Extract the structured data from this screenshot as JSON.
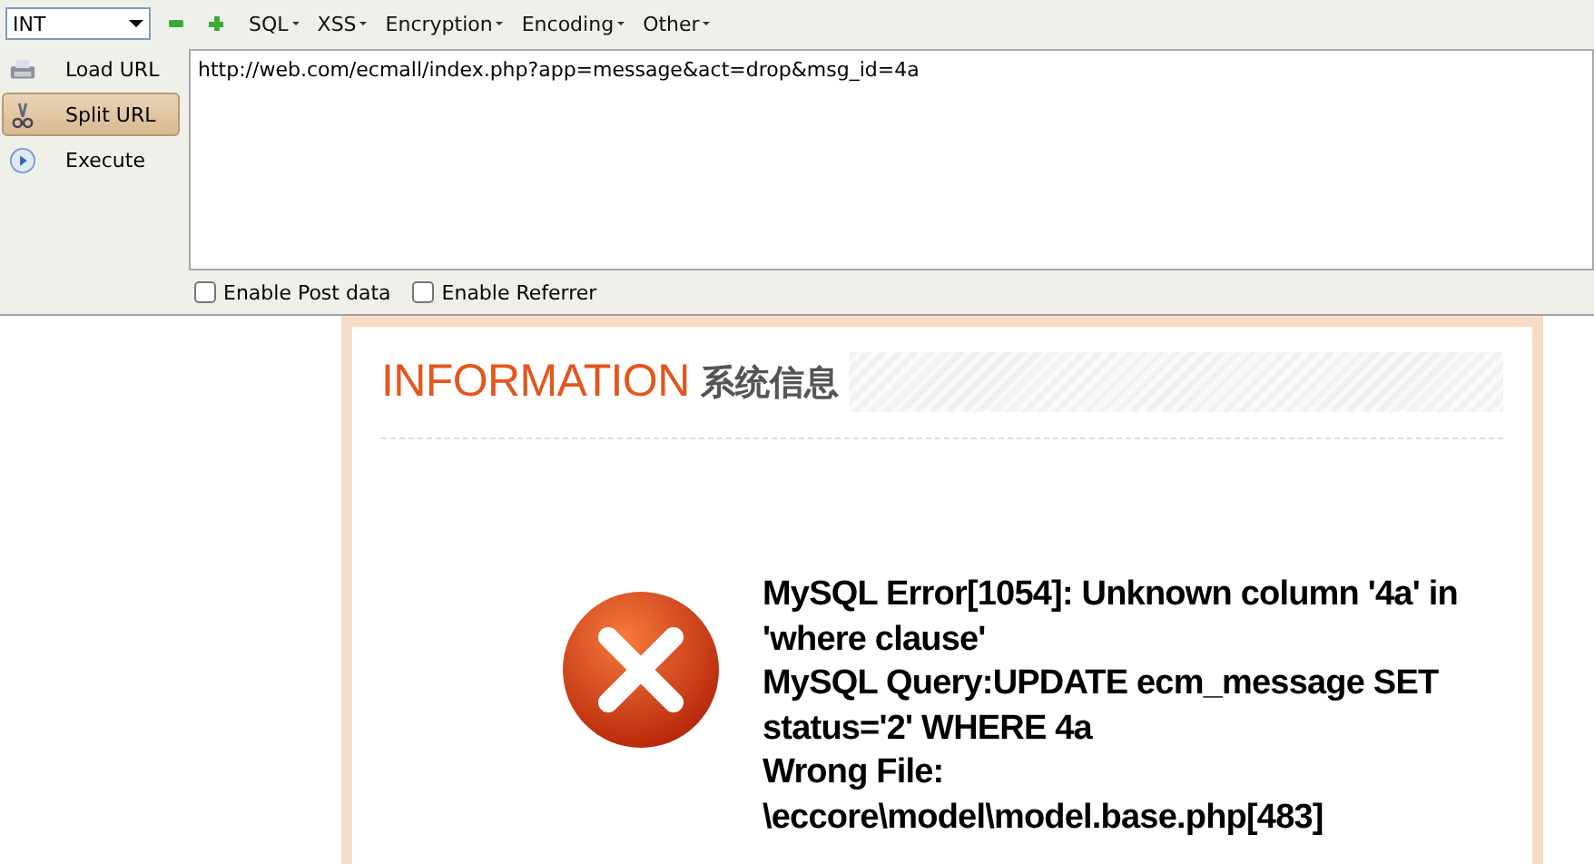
{
  "toolbar": {
    "dropdown": {
      "value": "INT"
    },
    "menus": [
      {
        "label": "SQL"
      },
      {
        "label": "XSS"
      },
      {
        "label": "Encryption"
      },
      {
        "label": "Encoding"
      },
      {
        "label": "Other"
      }
    ]
  },
  "sidebar": {
    "items": [
      {
        "label": "Load URL",
        "kind": "load",
        "selected": false
      },
      {
        "label": "Split URL",
        "kind": "split",
        "selected": true
      },
      {
        "label": "Execute",
        "kind": "execute",
        "selected": false
      }
    ]
  },
  "url_field": {
    "value": "http://web.com/ecmall/index.php?app=message&act=drop&msg_id=4a"
  },
  "options": [
    {
      "label": "Enable Post data",
      "checked": false
    },
    {
      "label": "Enable Referrer",
      "checked": false
    }
  ],
  "message": {
    "title": "INFORMATION",
    "subtitle": "系统信息",
    "lines": [
      "MySQL Error[1054]: Unknown column '4a' in 'where clause'",
      "MySQL Query:UPDATE ecm_message SET status='2' WHERE 4a",
      "Wrong File: \\eccore\\model\\model.base.php[483]"
    ]
  }
}
